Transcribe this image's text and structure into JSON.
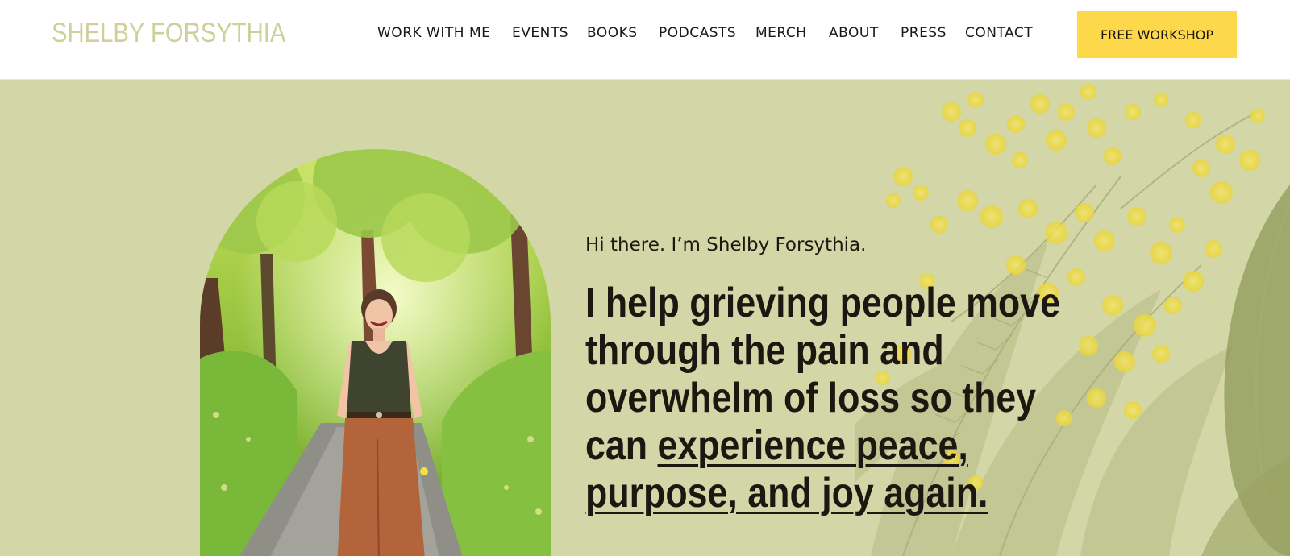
{
  "header": {
    "logo": "SHELBY FORSYTHIA",
    "nav": [
      {
        "label": "WORK WITH ME"
      },
      {
        "label": "EVENTS"
      },
      {
        "label": "BOOKS"
      },
      {
        "label": "PODCASTS"
      },
      {
        "label": "MERCH"
      },
      {
        "label": "ABOUT"
      },
      {
        "label": "PRESS"
      },
      {
        "label": "CONTACT"
      }
    ],
    "cta_label": "FREE WORKSHOP"
  },
  "hero": {
    "greeting": "Hi there. I’m Shelby Forsythia.",
    "headline_plain": "I help grieving people move through the pain and overwhelm of loss so they can ",
    "headline_underlined": "experience peace, purpose, and joy again."
  },
  "colors": {
    "hero_bg": "#d3d6a6",
    "accent_yellow": "#fcd84a",
    "logo": "#cfcf9a",
    "text_dark": "#1e1711"
  },
  "icons": {
    "hero_photo": "woman-on-forest-path-photo",
    "background_art": "mimosa-flowers-illustration"
  }
}
